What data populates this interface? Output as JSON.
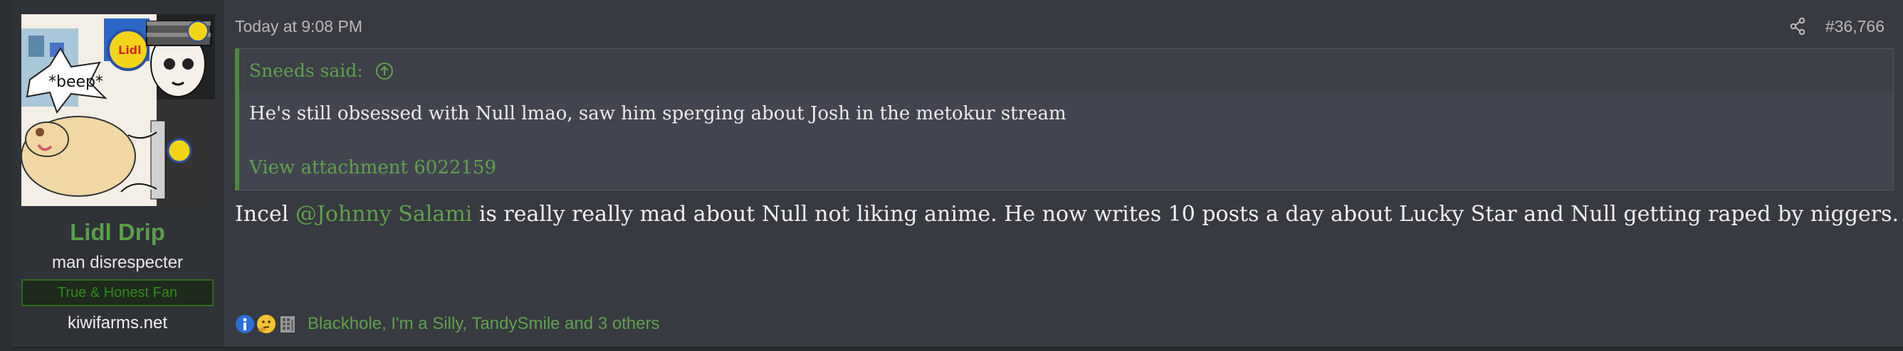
{
  "user": {
    "name": "Lidl Drip",
    "title": "man disrespecter",
    "banner": "True & Honest Fan",
    "extra": "kiwifarms.net",
    "avatar_caption": "*beep*",
    "avatar_logo": "Lidl"
  },
  "post": {
    "timestamp": "Today at 9:08 PM",
    "number": "#36,766",
    "share_icon": "share-icon",
    "quote": {
      "author": "Sneeds said:",
      "text": "He's still obsessed with Null lmao, saw him sperging about Josh in the metokur stream",
      "attachment": "View attachment 6022159"
    },
    "body": {
      "before": "Incel ",
      "mention": "@Johnny Salami",
      "after": " is really really mad about Null not liking anime. He now writes 10 posts a day about Lucky Star and Null getting raped by niggers."
    },
    "reactions": {
      "icons": [
        "informative-icon",
        "thinking-icon",
        "building-icon"
      ],
      "list": "Blackhole, I'm a Silly, TandySmile and 3 others"
    }
  },
  "colors": {
    "accent_green": "#5fa14c",
    "username_green": "#5a9e4a",
    "post_bg": "#373a40",
    "quote_bg": "#424550"
  }
}
